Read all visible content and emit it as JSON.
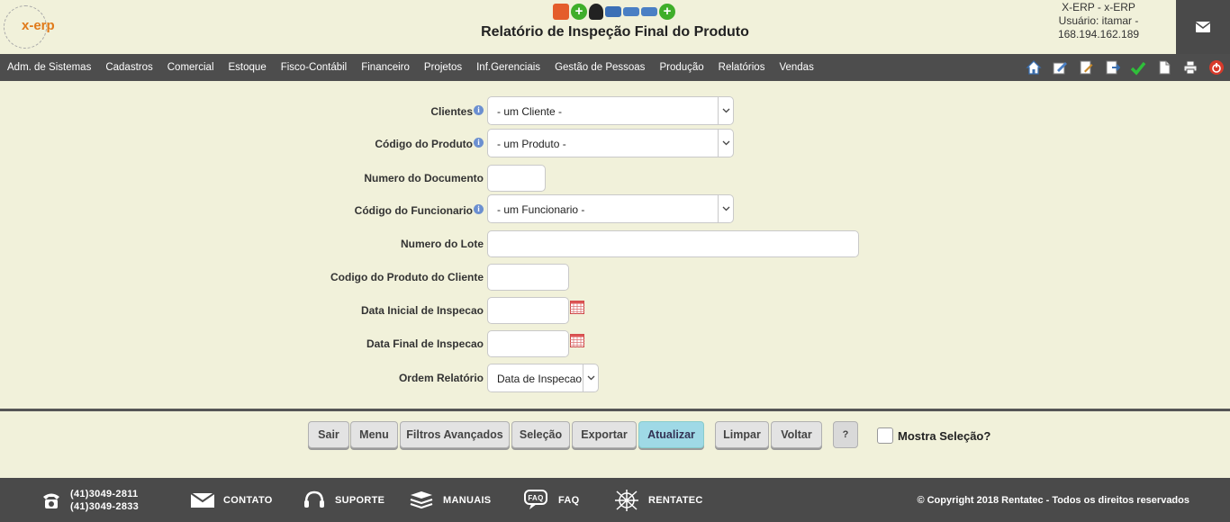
{
  "header": {
    "logo_text": "x-erp",
    "title": "Relatório de Inspeção Final do Produto",
    "system": "X-ERP - x-ERP",
    "user": "Usuário: itamar -",
    "ip": "168.194.162.189"
  },
  "nav": {
    "items": [
      "Adm. de Sistemas",
      "Cadastros",
      "Comercial",
      "Estoque",
      "Fisco-Contábil",
      "Financeiro",
      "Projetos",
      "Inf.Gerenciais",
      "Gestão de Pessoas",
      "Produção",
      "Relatórios",
      "Vendas"
    ]
  },
  "form": {
    "clientes_label": "Clientes",
    "clientes_value": "- um Cliente -",
    "produto_label": "Código do Produto",
    "produto_value": "- um Produto -",
    "documento_label": "Numero do Documento",
    "funcionario_label": "Código do Funcionario",
    "funcionario_value": "- um Funcionario -",
    "lote_label": "Numero do Lote",
    "produto_cliente_label": "Codigo do Produto do Cliente",
    "data_inicial_label": "Data Inicial de Inspecao",
    "data_final_label": "Data Final de Inspecao",
    "ordem_label": "Ordem Relatório",
    "ordem_value": "Data de Inspecao",
    "info_glyph": "i"
  },
  "buttons": {
    "sair": "Sair",
    "menu": "Menu",
    "filtros": "Filtros Avançados",
    "selecao": "Seleção",
    "exportar": "Exportar",
    "atualizar": "Atualizar",
    "limpar": "Limpar",
    "voltar": "Voltar",
    "help": "?",
    "mostra_selecao": "Mostra Seleção?"
  },
  "footer": {
    "phone1": "(41)3049-2811",
    "phone2": "(41)3049-2833",
    "contato": "CONTATO",
    "suporte": "SUPORTE",
    "manuais": "MANUAIS",
    "faq": "FAQ",
    "rentatec": "RENTATEC",
    "copyright": "© Copyright 2018 Rentatec - Todos os direitos reservados"
  },
  "colors": {
    "background": "#f1f1da",
    "nav": "#4d4d4d",
    "primary_button": "#9fd9e6",
    "footer": "#4a4a4a"
  }
}
